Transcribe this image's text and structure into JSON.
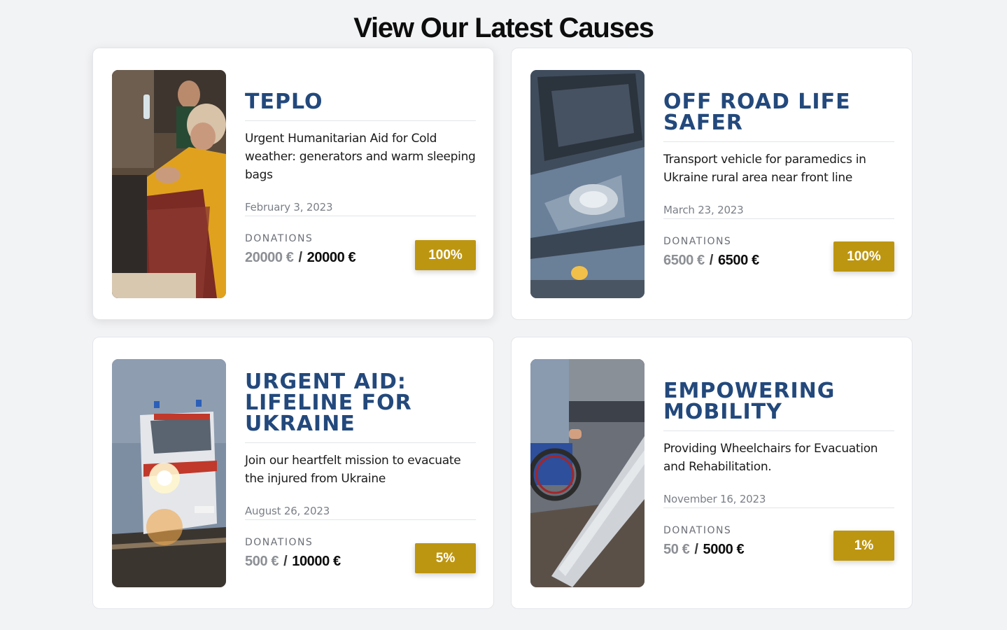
{
  "page": {
    "title": "View Our Latest Causes"
  },
  "colors": {
    "title_blue": "#23497c",
    "percent_gold": "#bd9611",
    "background": "#f2f3f5"
  },
  "causes": [
    {
      "title": "TEPLO",
      "description": "Urgent Humanitarian Aid for Cold weather: generators and warm sleeping bags",
      "date": "February 3, 2023",
      "donations_label": "DONATIONS",
      "raised": "20000 €",
      "separator": "/",
      "goal": "20000 €",
      "percent_label": "100%",
      "progress_percent": 100,
      "image": "people-sheltering-in-basement-photo"
    },
    {
      "title": "OFF ROAD LIFE SAFER",
      "description": "Transport vehicle for paramedics in Ukraine rural area near front line",
      "date": "March 23, 2023",
      "donations_label": "DONATIONS",
      "raised": "6500 €",
      "separator": "/",
      "goal": "6500 €",
      "percent_label": "100%",
      "progress_percent": 100,
      "image": "blue-suv-photo"
    },
    {
      "title": "URGENT AID: LIFELINE FOR UKRAINE",
      "description": "Join our heartfelt mission to evacuate the injured from Ukraine",
      "date": "August 26, 2023",
      "donations_label": "DONATIONS",
      "raised": "500 €",
      "separator": "/",
      "goal": "10000 €",
      "percent_label": "5%",
      "progress_percent": 5,
      "image": "evacuation-ambulance-photo"
    },
    {
      "title": "EMPOWERING MOBILITY",
      "description": "Providing Wheelchairs for Evacuation and Rehabilitation.",
      "date": "November 16, 2023",
      "donations_label": "DONATIONS",
      "raised": "50 €",
      "separator": "/",
      "goal": "5000 €",
      "percent_label": "1%",
      "progress_percent": 1,
      "image": "wheelchair-ramp-photo"
    }
  ]
}
